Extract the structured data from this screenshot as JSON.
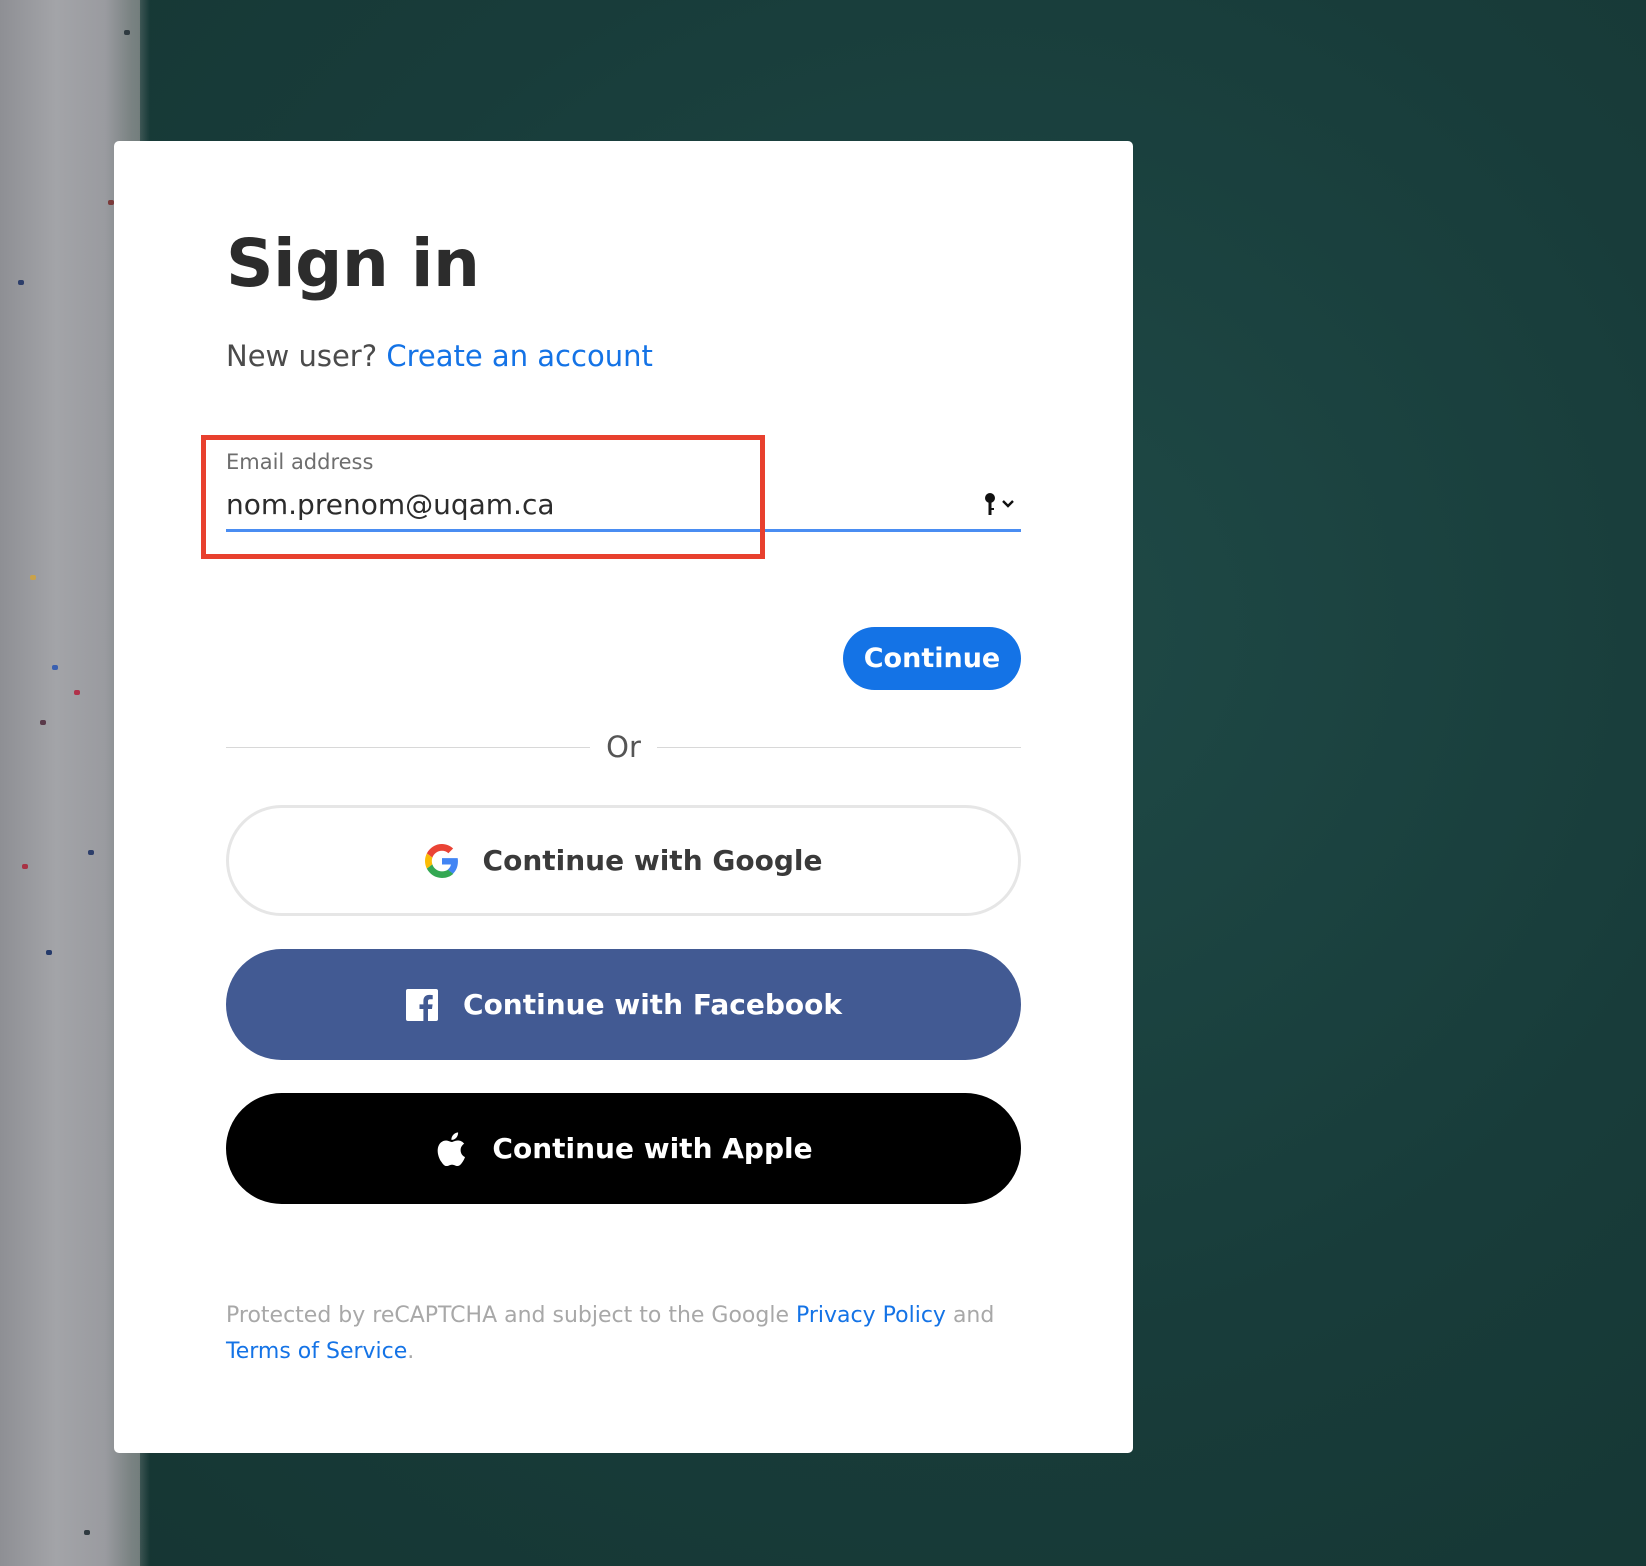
{
  "signin": {
    "title": "Sign in",
    "new_user_prompt": "New user?",
    "create_account_link": "Create an account",
    "email_label": "Email address",
    "email_value": "nom.prenom@uqam.ca",
    "continue_label": "Continue",
    "or_label": "Or"
  },
  "social": {
    "google_label": "Continue with Google",
    "facebook_label": "Continue with Facebook",
    "apple_label": "Continue with Apple"
  },
  "legal": {
    "prefix": "Protected by reCAPTCHA and subject to the Google",
    "privacy_link": "Privacy Policy",
    "and_text": "and",
    "terms_link": "Terms of Service",
    "suffix": "."
  },
  "colors": {
    "accent": "#1473e6",
    "facebook": "#425a93",
    "apple": "#000000",
    "highlight": "#e8402e",
    "background": "#1f4a47"
  },
  "icons": [
    "google-icon",
    "facebook-icon",
    "apple-icon",
    "key-icon",
    "chevron-down-icon"
  ]
}
